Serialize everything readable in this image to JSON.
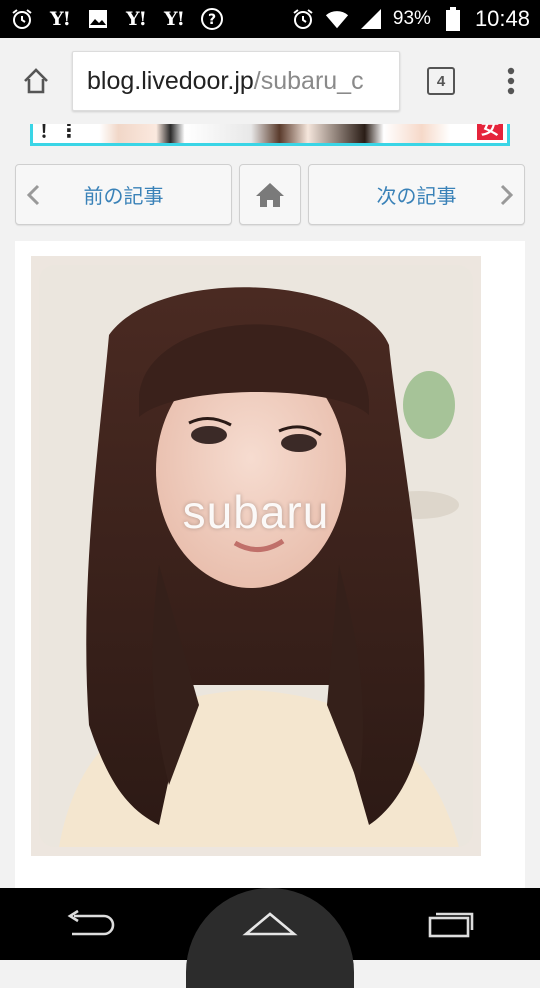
{
  "status_bar": {
    "left_icons": [
      "alarm-icon",
      "yahoo-icon",
      "gallery-icon",
      "yahoo-icon",
      "yahoo-icon",
      "help-icon"
    ],
    "yahoo_label": "Y!",
    "battery_percent": "93%",
    "clock": "10:48"
  },
  "browser": {
    "url_host": "blog.livedoor.jp",
    "url_path": "/subaru_c",
    "tab_count": "4"
  },
  "banner": {
    "mark_text": "！⋮",
    "badge_text": "女"
  },
  "article_nav": {
    "prev_label": "前の記事",
    "next_label": "次の記事"
  },
  "photo": {
    "watermark": "subaru"
  },
  "colors": {
    "link_blue": "#3a82b8",
    "banner_border": "#3ad5e6",
    "badge_red": "#e5243b"
  }
}
